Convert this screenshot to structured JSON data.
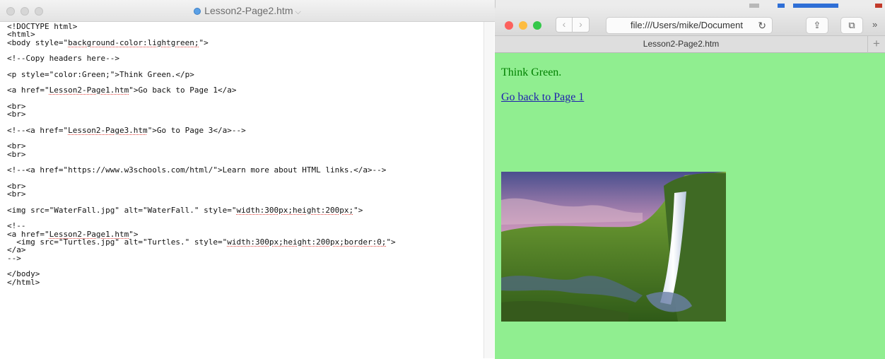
{
  "editor": {
    "title": "Lesson2-Page2.htm",
    "title_chevron": "⌵",
    "code_lines": [
      "<!DOCTYPE html>",
      "<html>",
      "<body style=\"background-color:lightgreen;\">",
      "",
      "<!--Copy headers here-->",
      "",
      "<p style=\"color:Green;\">Think Green.</p>",
      "",
      "<a href=\"Lesson2-Page1.htm\">Go back to Page 1</a>",
      "",
      "<br>",
      "<br>",
      "",
      "<!--<a href=\"Lesson2-Page3.htm\">Go to Page 3</a>-->",
      "",
      "<br>",
      "<br>",
      "",
      "<!--<a href=\"https://www.w3schools.com/html/\">Learn more about HTML links.</a>-->",
      "",
      "<br>",
      "<br>",
      "",
      "<img src=\"WaterFall.jpg\" alt=\"WaterFall.\" style=\"width:300px;height:200px;\">",
      "",
      "<!--",
      "<a href=\"Lesson2-Page1.htm\">",
      "  <img src=\"Turtles.jpg\" alt=\"Turtles.\" style=\"width:300px;height:200px;border:0;\">",
      "</a>",
      "-->",
      "",
      "</body>",
      "</html>"
    ],
    "spellcheck_words": [
      "background-color:lightgreen;",
      "Lesson2-Page1.htm",
      "Lesson2-Page3.htm",
      "width:300px;height:200px;",
      "width:300px;height:200px;border:0;"
    ]
  },
  "safari": {
    "address": "file:///Users/mike/Document",
    "reload_icon": "↻",
    "back_icon": "‹",
    "forward_icon": "›",
    "share_icon": "⇪",
    "tabs_icon": "⧉",
    "more_icon": "»",
    "tab_title": "Lesson2-Page2.htm",
    "add_tab": "+",
    "traffic_lights": [
      "#fc615d",
      "#fdbc40",
      "#34c84a"
    ]
  },
  "page": {
    "background": "lightgreen",
    "paragraph": "Think Green.",
    "paragraph_color": "green",
    "link_text": "Go back to Page 1",
    "image_alt": "WaterFall."
  }
}
